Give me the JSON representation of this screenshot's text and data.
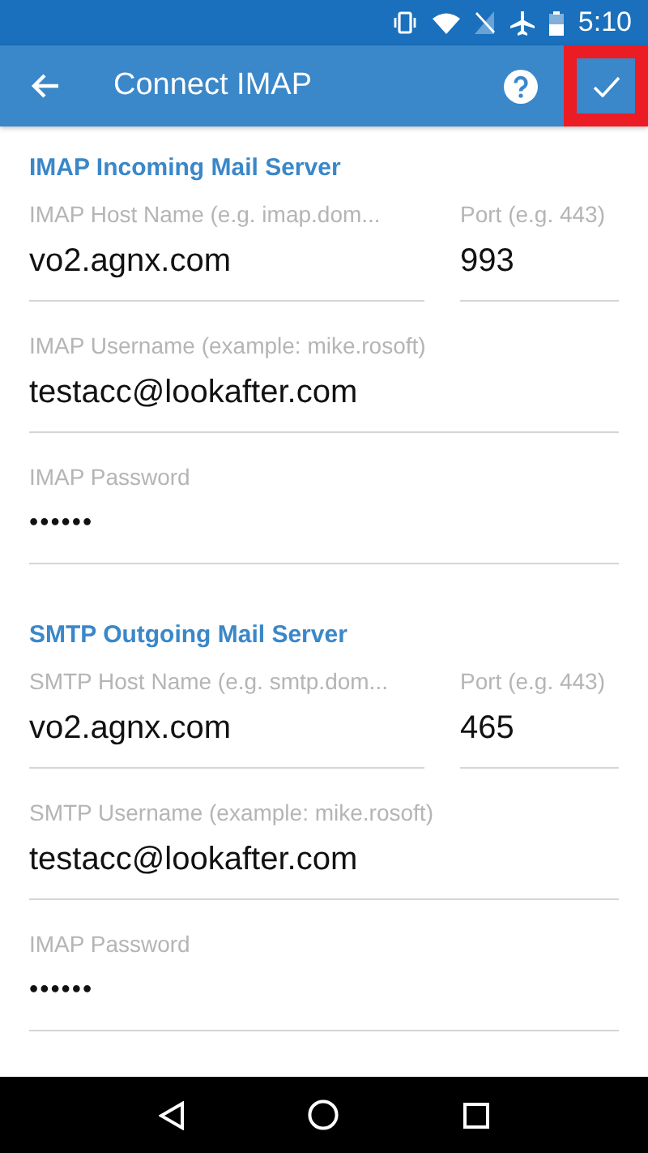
{
  "status_bar": {
    "time": "5:10"
  },
  "app_bar": {
    "title": "Connect IMAP",
    "confirm_highlighted": true
  },
  "sections": [
    {
      "heading": "IMAP Incoming Mail Server",
      "rows": [
        [
          {
            "label": "IMAP Host Name (e.g. imap.dom...",
            "value": "vo2.agnx.com",
            "kind": "text"
          },
          {
            "label": "Port (e.g. 443)",
            "value": "993",
            "kind": "port"
          }
        ],
        [
          {
            "label": "IMAP Username (example: mike.rosoft)",
            "value": "testacc@lookafter.com",
            "kind": "text"
          }
        ],
        [
          {
            "label": "IMAP Password",
            "value": "••••••",
            "kind": "password"
          }
        ]
      ]
    },
    {
      "heading": "SMTP Outgoing Mail Server",
      "rows": [
        [
          {
            "label": "SMTP Host Name (e.g. smtp.dom...",
            "value": "vo2.agnx.com",
            "kind": "text"
          },
          {
            "label": "Port (e.g. 443)",
            "value": "465",
            "kind": "port"
          }
        ],
        [
          {
            "label": "SMTP Username (example: mike.rosoft)",
            "value": "testacc@lookafter.com",
            "kind": "text"
          }
        ],
        [
          {
            "label": "IMAP Password",
            "value": "••••••",
            "kind": "password"
          }
        ]
      ]
    }
  ]
}
